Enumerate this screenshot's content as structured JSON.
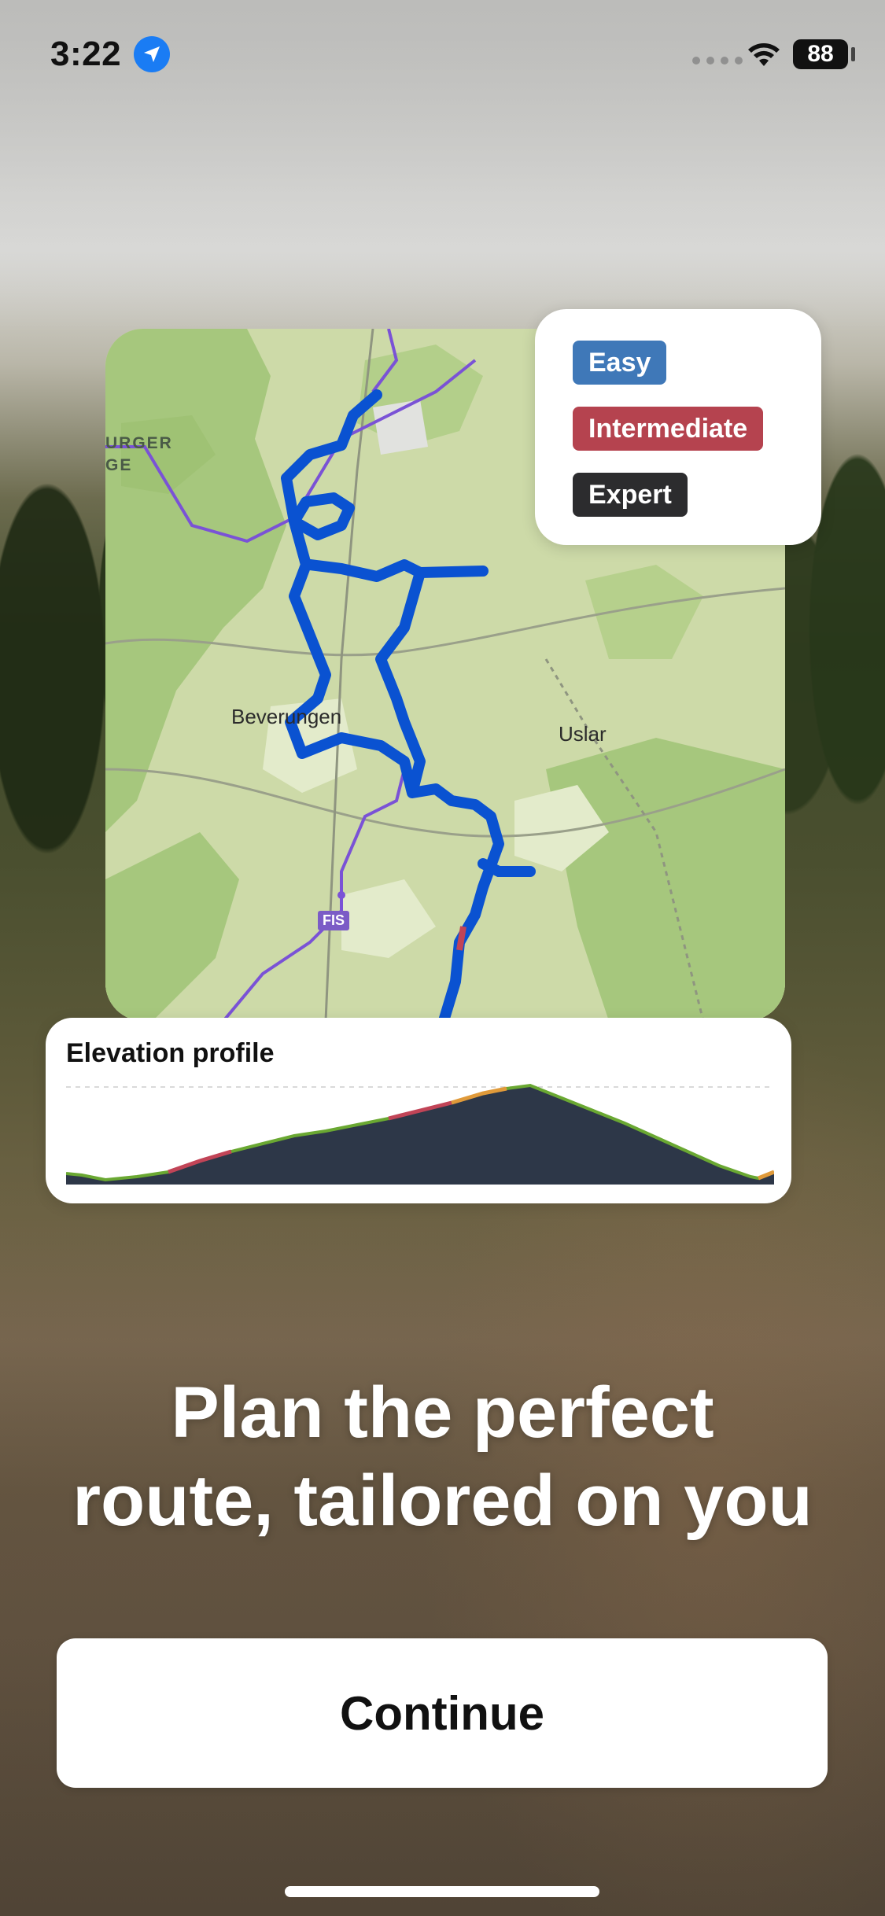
{
  "status_bar": {
    "time": "3:22",
    "battery": "88",
    "icons": [
      "location-arrow-icon",
      "cellular-signal-icon",
      "wifi-icon",
      "battery-icon"
    ]
  },
  "map": {
    "labels": {
      "town_1": "Beverungen",
      "town_2": "Uslar",
      "edge_1": "URGER",
      "edge_2": "GE",
      "route_badge": "FIS"
    },
    "route_color": "#0a52d1"
  },
  "legend": {
    "items": [
      {
        "label": "Easy",
        "color": "#3f78b8"
      },
      {
        "label": "Intermediate",
        "color": "#b5434f"
      },
      {
        "label": "Expert",
        "color": "#2c2c2e"
      }
    ]
  },
  "elevation": {
    "title": "Elevation profile",
    "fill_color": "#2d3748",
    "line_color": "#6aa832"
  },
  "headline": {
    "line1": "Plan the perfect",
    "line2": "route, tailored on you"
  },
  "continue_button": {
    "label": "Continue"
  }
}
